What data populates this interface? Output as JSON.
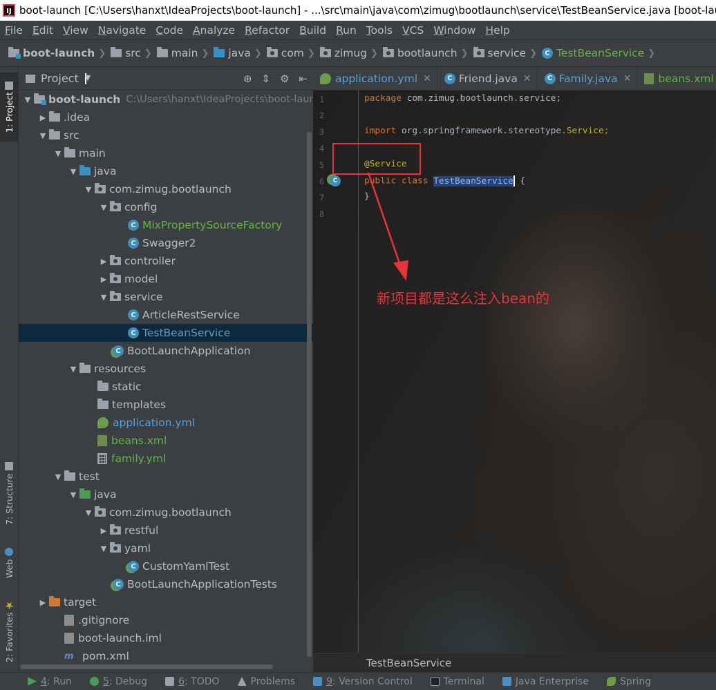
{
  "window": {
    "title": "boot-launch [C:\\Users\\hanxt\\IdeaProjects\\boot-launch] - ...\\src\\main\\java\\com\\zimug\\bootlaunch\\service\\TestBeanService.java [boot-launc"
  },
  "menu": [
    "File",
    "Edit",
    "View",
    "Navigate",
    "Code",
    "Analyze",
    "Refactor",
    "Build",
    "Run",
    "Tools",
    "VCS",
    "Window",
    "Help"
  ],
  "nav_breadcrumb": [
    "boot-launch",
    "src",
    "main",
    "java",
    "com",
    "zimug",
    "bootlaunch",
    "service",
    "TestBeanService"
  ],
  "left_strip": {
    "project": "1: Project",
    "structure": "7: Structure",
    "web": "Web",
    "favorites": "2: Favorites"
  },
  "project_panel": {
    "title": "Project",
    "root_path": "C:\\Users\\hanxt\\IdeaProjects\\boot-laun",
    "tree": [
      {
        "label": "boot-launch"
      },
      {
        "label": ".idea"
      },
      {
        "label": "src"
      },
      {
        "label": "main"
      },
      {
        "label": "java"
      },
      {
        "label": "com.zimug.bootlaunch"
      },
      {
        "label": "config"
      },
      {
        "label": "MixPropertySourceFactory"
      },
      {
        "label": "Swagger2"
      },
      {
        "label": "controller"
      },
      {
        "label": "model"
      },
      {
        "label": "service"
      },
      {
        "label": "ArticleRestService"
      },
      {
        "label": "TestBeanService"
      },
      {
        "label": "BootLaunchApplication"
      },
      {
        "label": "resources"
      },
      {
        "label": "static"
      },
      {
        "label": "templates"
      },
      {
        "label": "application.yml"
      },
      {
        "label": "beans.xml"
      },
      {
        "label": "family.yml"
      },
      {
        "label": "test"
      },
      {
        "label": "java"
      },
      {
        "label": "com.zimug.bootlaunch"
      },
      {
        "label": "restful"
      },
      {
        "label": "yaml"
      },
      {
        "label": "CustomYamlTest"
      },
      {
        "label": "BootLaunchApplicationTests"
      },
      {
        "label": "target"
      },
      {
        "label": ".gitignore"
      },
      {
        "label": "boot-launch.iml"
      },
      {
        "label": "pom.xml"
      }
    ]
  },
  "editor_tabs": [
    {
      "label": "application.yml"
    },
    {
      "label": "Friend.java"
    },
    {
      "label": "Family.java"
    },
    {
      "label": "beans.xml"
    }
  ],
  "code": {
    "line_numbers": [
      "1",
      "2",
      "3",
      "4",
      "5",
      "6",
      "7",
      "8"
    ],
    "line1_kw": "package",
    "line1_rest": " com.zimug.bootlaunch.service;",
    "line3_kw": "import",
    "line3_mid": " org.springframework.stereotype.",
    "line3_cls": "Service",
    "line3_end": ";",
    "line5_ann": "@Service",
    "line6_kw": "public class",
    "line6_sp": " ",
    "line6_name": "TestBeanService",
    "line6_end": " {",
    "line7": "}"
  },
  "annotation_text": "新项目都是这么注入bean的",
  "editor_breadcrumb": "TestBeanService",
  "bottom_tabs": [
    {
      "num": "4",
      "label": ": Run"
    },
    {
      "num": "5",
      "label": ": Debug"
    },
    {
      "num": "6",
      "label": ": TODO"
    },
    {
      "num": "",
      "label": "Problems"
    },
    {
      "num": "9",
      "label": ": Version Control"
    },
    {
      "num": "",
      "label": "Terminal"
    },
    {
      "num": "",
      "label": "Java Enterprise"
    },
    {
      "num": "",
      "label": "Spring"
    }
  ],
  "colors": {
    "background": "#2b2b2b",
    "panel": "#3c3f41",
    "selection": "#0d293e",
    "keyword": "#cc7832",
    "annotation": "#bbb529",
    "annotation_mark": "#e8333a"
  }
}
